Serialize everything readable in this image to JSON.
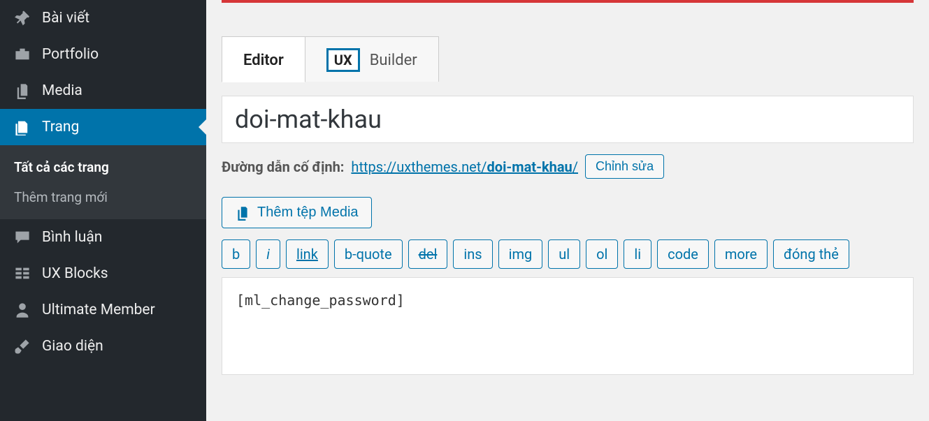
{
  "sidebar": {
    "items": [
      {
        "id": "posts",
        "label": "Bài viết"
      },
      {
        "id": "portfolio",
        "label": "Portfolio"
      },
      {
        "id": "media",
        "label": "Media"
      },
      {
        "id": "pages",
        "label": "Trang"
      },
      {
        "id": "comments",
        "label": "Bình luận"
      },
      {
        "id": "uxblocks",
        "label": "UX Blocks"
      },
      {
        "id": "ultimatemember",
        "label": "Ultimate Member"
      },
      {
        "id": "appearance",
        "label": "Giao diện"
      }
    ],
    "sub": [
      {
        "id": "all",
        "label": "Tất cả các trang"
      },
      {
        "id": "addnew",
        "label": "Thêm trang mới"
      }
    ]
  },
  "tabs": {
    "editor": "Editor",
    "uxbox": "UX",
    "builder": "Builder"
  },
  "title": "doi-mat-khau",
  "permalink": {
    "label": "Đường dẫn cố định:",
    "base": "https://uxthemes.net/",
    "slug": "doi-mat-khau",
    "trail": "/",
    "edit": "Chỉnh sửa"
  },
  "media_button": "Thêm tệp Media",
  "quicktags": {
    "b": "b",
    "i": "i",
    "link": "link",
    "bquote": "b-quote",
    "del": "del",
    "ins": "ins",
    "img": "img",
    "ul": "ul",
    "ol": "ol",
    "li": "li",
    "code": "code",
    "more": "more",
    "close": "đóng thẻ"
  },
  "editor_content": "[ml_change_password]"
}
